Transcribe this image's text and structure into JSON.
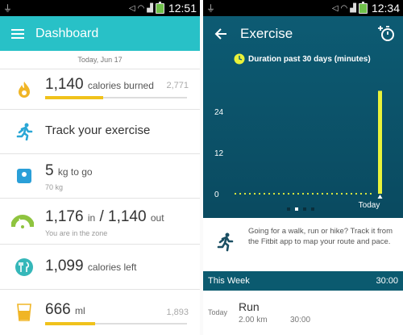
{
  "left_screen": {
    "status": {
      "time": "12:51"
    },
    "header": {
      "title": "Dashboard"
    },
    "date": "Today, Jun 17",
    "tiles": [
      {
        "value": "1,140",
        "unit": "calories burned",
        "goal": "2,771",
        "progress": 0.41
      },
      {
        "value": "Track your exercise"
      },
      {
        "value": "5",
        "unit": "kg to go",
        "sub": "70 kg"
      },
      {
        "value": "1,176",
        "unit_in": "in",
        "sep": "/",
        "value2": "1,140",
        "unit_out": "out",
        "sub": "You are in the zone"
      },
      {
        "value": "1,099",
        "unit": "calories left"
      },
      {
        "value": "666",
        "unit": "ml",
        "goal": "1,893",
        "progress": 0.35
      }
    ]
  },
  "right_screen": {
    "status": {
      "time": "12:34"
    },
    "header": {
      "title": "Exercise"
    },
    "chart_title": "Duration past 30 days (minutes)",
    "chart_data": {
      "type": "bar",
      "title": "Duration past 30 days (minutes)",
      "ytick_labels": [
        "24",
        "12",
        "0"
      ],
      "ylim": [
        0,
        30
      ],
      "categories": [
        "Today"
      ],
      "values": [
        30
      ],
      "baseline_dots": true
    },
    "pager_dots": 4,
    "pager_active": 1,
    "info_text": "Going for a walk, run or hike? Track it from the Fitbit app to map your route and pace.",
    "this_week": {
      "label": "This Week",
      "duration": "30:00"
    },
    "activities": [
      {
        "day": "Today",
        "name": "Run",
        "distance": "2.00 km",
        "duration": "30:00"
      }
    ]
  },
  "colors": {
    "teal": "#28c1c7",
    "yellow": "#f0c21b",
    "chart_bar": "#e9f23a",
    "exercise_bg": "#0d5b73"
  }
}
